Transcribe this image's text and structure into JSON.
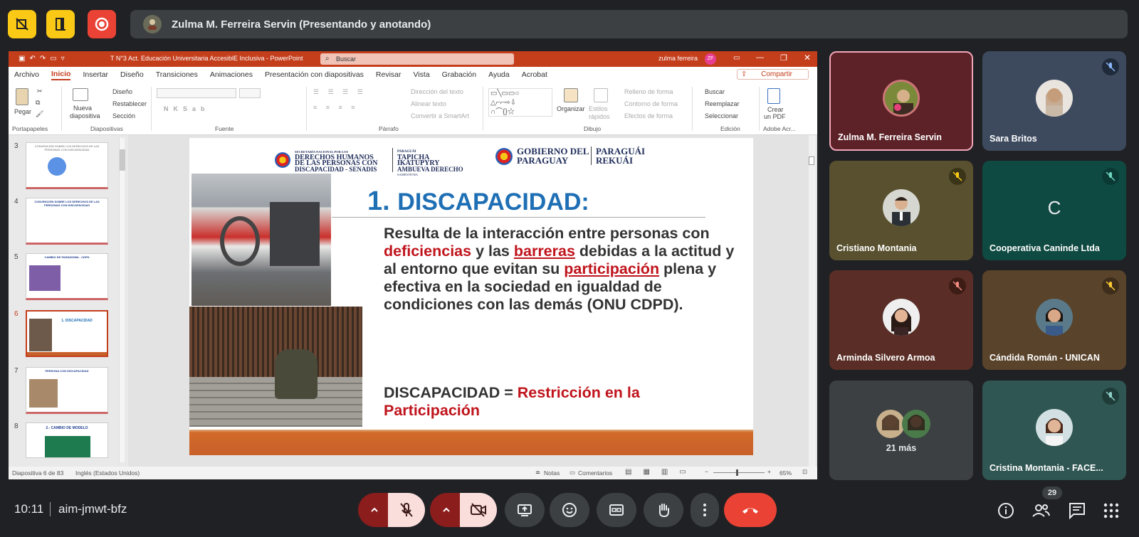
{
  "topbar": {
    "presenter_label": "Zulma M. Ferreira Servin (Presentando y anotando)"
  },
  "ppt": {
    "window_title": "T N°3 Act. Educación Universitaria AccesiblE Inclusiva  -  PowerPoint",
    "search_placeholder": "Buscar",
    "user_name": "zulma ferreira",
    "user_initials": "ZF",
    "menu": [
      "Archivo",
      "Inicio",
      "Insertar",
      "Diseño",
      "Transiciones",
      "Animaciones",
      "Presentación con diapositivas",
      "Revisar",
      "Vista",
      "Grabación",
      "Ayuda",
      "Acrobat"
    ],
    "share_label": "Compartir",
    "ribbon": {
      "pegar": "Pegar",
      "portapapeles": "Portapapeles",
      "nueva_diapositiva": "Nueva",
      "nueva_diapositiva2": "diapositiva",
      "diseno": "Diseño",
      "restablecer": "Restablecer",
      "seccion": "Sección",
      "diapositivas": "Diapositivas",
      "fuente": "Fuente",
      "parrafo": "Párrafo",
      "direccion_texto": "Dirección del texto",
      "alinear_texto": "Alinear texto",
      "convertir_smartart": "Convertir a SmartArt",
      "organizar": "Organizar",
      "estilos": "Estilos",
      "estilos2": "rápidos",
      "relleno_forma": "Relleno de forma",
      "contorno_forma": "Contorno de forma",
      "efectos_forma": "Efectos de forma",
      "dibujo": "Dibujo",
      "buscar": "Buscar",
      "reemplazar": "Reemplazar",
      "seleccionar": "Seleccionar",
      "edicion": "Edición",
      "crear_pdf": "Crear",
      "crear_pdf2": "un PDF",
      "adobe": "Adobe Acr..."
    },
    "thumbnails": [
      {
        "num": "3",
        "label": "CONVENCIÓN SOBRE LOS DERECHOS DE LAS PERSONAS CON DISCAPACIDAD"
      },
      {
        "num": "4",
        "label": "CONVENCIÓN SOBRE LOS DERECHOS DE LAS PERSONAS CON DISCAPACIDAD"
      },
      {
        "num": "5",
        "label": "CAMBIO DE PARADIGMA - CDPD"
      },
      {
        "num": "6",
        "label": "1. DISCAPACIDAD"
      },
      {
        "num": "7",
        "label": "PERSONA CON DISCAPACIDAD"
      },
      {
        "num": "8",
        "label": "2.- CAMBIO DE MODELO"
      }
    ],
    "status_left": "Diapositiva 6 de 83",
    "status_lang": "Inglés (Estados Unidos)",
    "status_notes": "Notas",
    "status_comments": "Comentarios",
    "zoom": "65%"
  },
  "slide": {
    "logo1_line1": "SECRETARÍA NACIONAL POR LOS",
    "logo1_line2": "DERECHOS HUMANOS",
    "logo1_line3": "DE LAS PERSONAS CON",
    "logo1_line4": "DISCAPACIDAD - SENADIS",
    "logo1_line5": "PARAGUAY",
    "logo1_gn1": "PARAGUÁI",
    "logo1_gn2": "TAPICHA",
    "logo1_gn3": "IKATUPYRY",
    "logo1_gn4": "AMBUEVA DERECHO",
    "logo1_gn5": "SAMBYHYHA",
    "logo2_line1": "GOBIERNO DEL",
    "logo2_line2": "PARAGUAY",
    "logo2_gn1": "PARAGUÁI",
    "logo2_gn2": "REKUÁI",
    "heading_num": "1.",
    "heading": "DISCAPACIDAD:",
    "body_1": "Resulta de la interacción entre personas con ",
    "body_2": "deficiencias",
    "body_3": " y las ",
    "body_4": "barreras",
    "body_5": " debidas a la actitud y al entorno que evitan su ",
    "body_6": "participación",
    "body_7": " plena y efectiva en la sociedad en igualdad de condiciones con las demás (ONU CDPD).",
    "eq_1": "DISCAPACIDAD = ",
    "eq_2": "Restricción en la Participación"
  },
  "participants": [
    {
      "name": "Zulma M. Ferreira Servin",
      "bg": "#5c2228"
    },
    {
      "name": "Sara Britos",
      "bg": "#3d4a5e"
    },
    {
      "name": "Cristiano Montania",
      "bg": "#58502e"
    },
    {
      "name": "Cooperativa Caninde Ltda",
      "bg": "#0f4a42",
      "initial": "C"
    },
    {
      "name": "Arminda Silvero Armoa",
      "bg": "#5a2e26"
    },
    {
      "name": "Cándida Román - UNICAN",
      "bg": "#59432b"
    },
    {
      "name": "21 más",
      "bg": "#3c4043"
    },
    {
      "name": "Cristina Montania - FACE...",
      "bg": "#2f5652"
    }
  ],
  "bottom": {
    "time": "10:11",
    "meeting_code": "aim-jmwt-bfz",
    "people_count": "29"
  },
  "colors": {
    "ppt_accent": "#c43e1c",
    "slide_blue": "#1f6fb5",
    "slide_red": "#c0141c",
    "end_call": "#ea4335",
    "muted_red": "#8c1d1d"
  }
}
